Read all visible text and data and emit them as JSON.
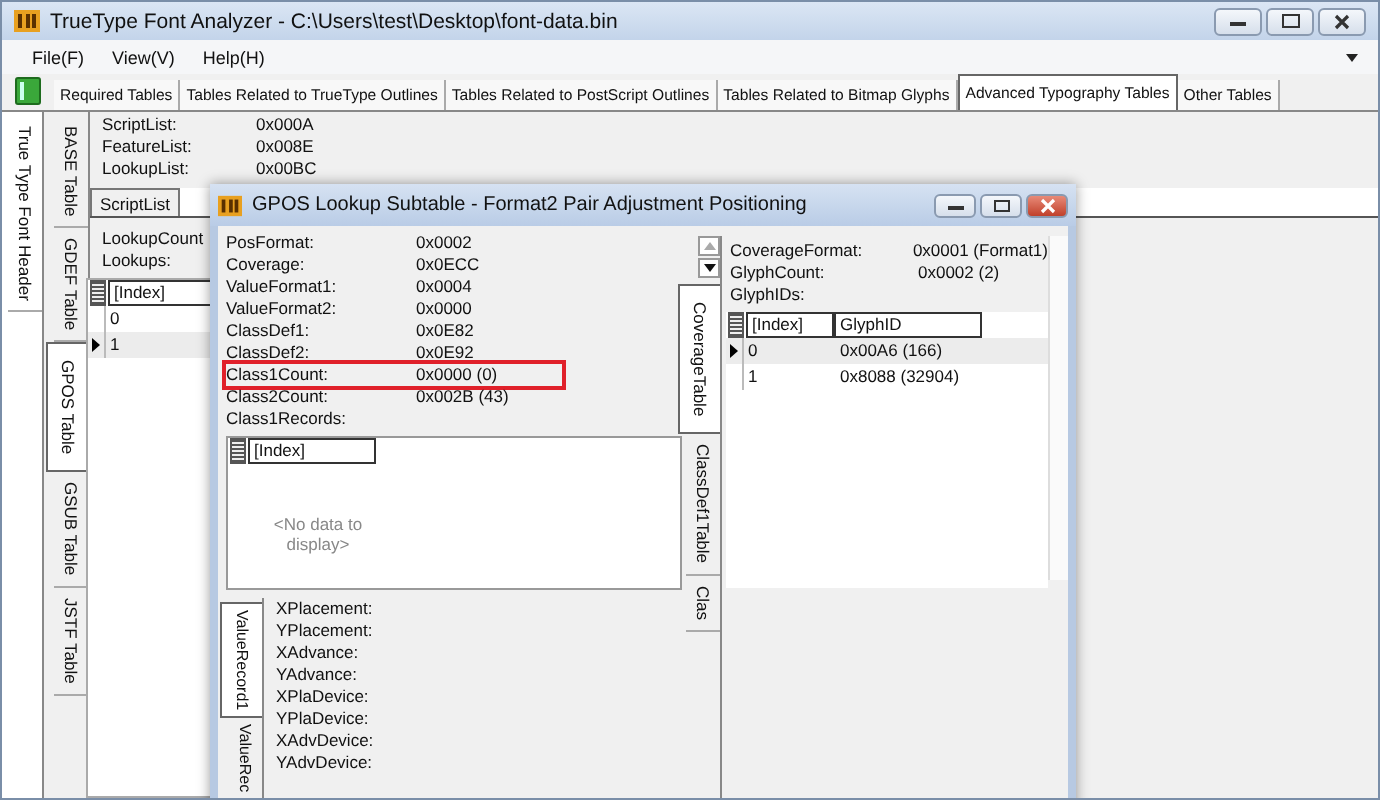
{
  "window": {
    "title": "TrueType Font Analyzer - C:\\Users\\test\\Desktop\\font-data.bin"
  },
  "menu": [
    {
      "label": "File(F)"
    },
    {
      "label": "View(V)"
    },
    {
      "label": "Help(H)"
    }
  ],
  "top_tabs": [
    {
      "label": "Required Tables",
      "selected": false
    },
    {
      "label": "Tables Related to TrueType Outlines",
      "selected": false
    },
    {
      "label": "Tables Related to PostScript Outlines",
      "selected": false
    },
    {
      "label": "Tables Related to Bitmap Glyphs",
      "selected": false
    },
    {
      "label": "Advanced Typography Tables",
      "selected": true
    },
    {
      "label": "Other Tables",
      "selected": false
    }
  ],
  "side_tabs": [
    {
      "label": "True Type Font Header",
      "selected": false
    }
  ],
  "table_tabs": [
    {
      "label": "BASE Table",
      "selected": false
    },
    {
      "label": "GDEF Table",
      "selected": false
    },
    {
      "label": "GPOS Table",
      "selected": true
    },
    {
      "label": "GSUB Table",
      "selected": false
    },
    {
      "label": "JSTF Table",
      "selected": false
    }
  ],
  "header_fields": [
    {
      "label": "ScriptList:",
      "value": "0x000A"
    },
    {
      "label": "FeatureList:",
      "value": "0x008E"
    },
    {
      "label": "LookupList:",
      "value": "0x00BC"
    }
  ],
  "sub_tabs": [
    {
      "label": "ScriptList",
      "selected": true
    }
  ],
  "lookup_fields": [
    {
      "label": "LookupCount"
    },
    {
      "label": "Lookups:"
    }
  ],
  "lookups_table": {
    "columns": [
      "[Index]"
    ],
    "rows": [
      {
        "cells": [
          "0"
        ],
        "selected": false
      },
      {
        "cells": [
          "1"
        ],
        "selected": true
      }
    ]
  },
  "dialog": {
    "title": "GPOS Lookup Subtable - Format2 Pair Adjustment Positioning",
    "fields": [
      {
        "label": "PosFormat:",
        "value": "0x0002",
        "highlighted": false
      },
      {
        "label": "Coverage:",
        "value": "0x0ECC",
        "highlighted": false
      },
      {
        "label": "ValueFormat1:",
        "value": "0x0004",
        "highlighted": false
      },
      {
        "label": "ValueFormat2:",
        "value": "0x0000",
        "highlighted": false
      },
      {
        "label": "ClassDef1:",
        "value": "0x0E82",
        "highlighted": false
      },
      {
        "label": "ClassDef2:",
        "value": "0x0E92",
        "highlighted": false
      },
      {
        "label": "Class1Count:",
        "value": "0x0000 (0)",
        "highlighted": true
      },
      {
        "label": "Class2Count:",
        "value": "0x002B (43)",
        "highlighted": false
      },
      {
        "label": "Class1Records:",
        "highlighted": false
      }
    ],
    "records_table": {
      "columns": [
        "[Index]"
      ],
      "empty_text": "<No data to display>"
    },
    "value_tabs": [
      {
        "label": "ValueRecord1",
        "selected": true
      },
      {
        "label": "ValueRec",
        "selected": false
      }
    ],
    "value_fields": [
      {
        "label": "XPlacement:"
      },
      {
        "label": "YPlacement:"
      },
      {
        "label": "XAdvance:"
      },
      {
        "label": "YAdvance:"
      },
      {
        "label": "XPlaDevice:"
      },
      {
        "label": "YPlaDevice:"
      },
      {
        "label": "XAdvDevice:"
      },
      {
        "label": "YAdvDevice:"
      }
    ],
    "right_tabs": [
      {
        "label": "CoverageTable",
        "selected": true
      },
      {
        "label": "ClassDef1Table",
        "selected": false
      },
      {
        "label": "Clas",
        "selected": false
      }
    ],
    "coverage_fields": [
      {
        "label": "CoverageFormat:",
        "value": "0x0001 (Format1)"
      },
      {
        "label": "GlyphCount:",
        "value": "0x0002 (2)"
      },
      {
        "label": "GlyphIDs:"
      }
    ],
    "glyph_table": {
      "columns": [
        "[Index]",
        "GlyphID"
      ],
      "rows": [
        {
          "cells": [
            "0",
            "0x00A6 (166)"
          ],
          "selected": true
        },
        {
          "cells": [
            "1",
            "0x8088 (32904)"
          ],
          "selected": false
        }
      ]
    }
  }
}
